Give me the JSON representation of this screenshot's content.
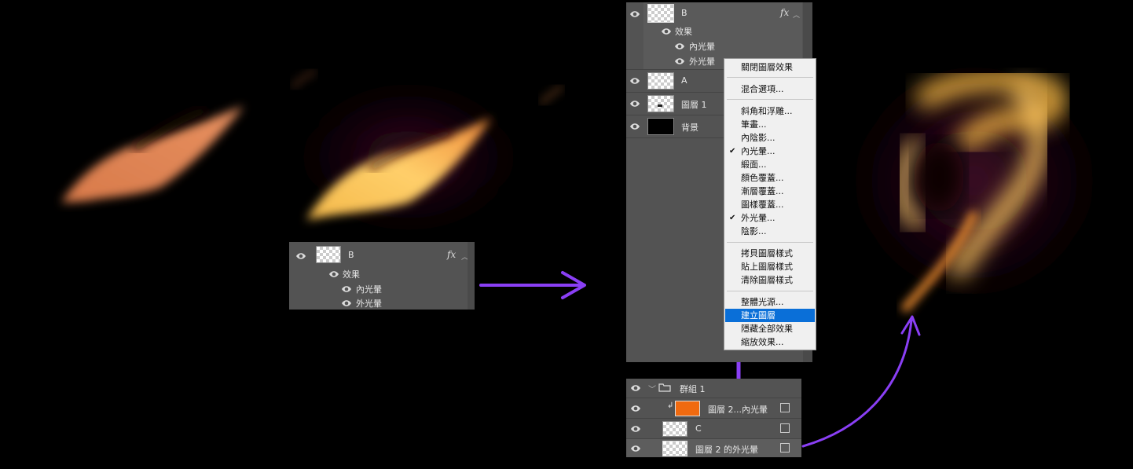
{
  "colors": {
    "accent_purple": "#8a3ff5",
    "panel_bg": "#535353",
    "menu_highlight": "#0a6fd8"
  },
  "small_panel": {
    "layer_name": "B",
    "fx_label": "fx",
    "effects_label": "效果",
    "effects": [
      "內光暈",
      "外光暈"
    ]
  },
  "layers_panel": {
    "top_layer": {
      "name": "B",
      "fx_label": "fx"
    },
    "effects_label": "效果",
    "effects": [
      "內光暈",
      "外光暈"
    ],
    "layers": [
      {
        "name": "A",
        "thumb": "checker"
      },
      {
        "name": "圖層 1",
        "thumb": "checker-mark"
      },
      {
        "name": "背景",
        "thumb": "black"
      }
    ]
  },
  "context_menu": {
    "groups": [
      [
        {
          "label": "關閉圖層效果"
        }
      ],
      [
        {
          "label": "混合選項..."
        }
      ],
      [
        {
          "label": "斜角和浮雕..."
        },
        {
          "label": "筆畫..."
        },
        {
          "label": "內陰影..."
        },
        {
          "label": "內光暈...",
          "checked": true
        },
        {
          "label": "緞面..."
        },
        {
          "label": "顏色覆蓋..."
        },
        {
          "label": "漸層覆蓋..."
        },
        {
          "label": "圖樣覆蓋..."
        },
        {
          "label": "外光暈...",
          "checked": true
        },
        {
          "label": "陰影..."
        }
      ],
      [
        {
          "label": "拷貝圖層樣式"
        },
        {
          "label": "貼上圖層樣式"
        },
        {
          "label": "清除圖層樣式"
        }
      ],
      [
        {
          "label": "整體光源..."
        },
        {
          "label": "建立圖層",
          "selected": true
        },
        {
          "label": "隱藏全部效果"
        },
        {
          "label": "縮放效果..."
        }
      ]
    ],
    "check_mark": "✔"
  },
  "bottom_panel": {
    "group_name": "群組 1",
    "layers": [
      {
        "name": "圖層 2...內光暈",
        "thumb": "orange",
        "clipped": true
      },
      {
        "name": "C",
        "thumb": "checker",
        "clipped": true
      },
      {
        "name": "圖層 2 的外光暈",
        "thumb": "checker",
        "clipped": false
      }
    ]
  },
  "icons": {
    "visibility": "eye-icon",
    "folder": "folder-icon",
    "clip": "clip-arrow-icon",
    "link": "link-icon",
    "expand": "chevron-up-icon",
    "group_toggle": "chevron-down-icon"
  }
}
